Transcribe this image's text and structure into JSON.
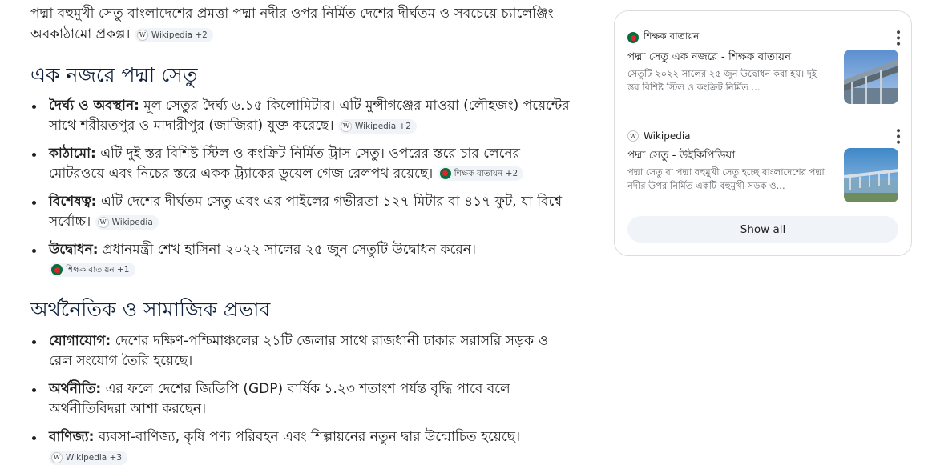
{
  "intro": {
    "text": "পদ্মা বহুমুখী সেতু বাংলাদেশের প্রমত্তা পদ্মা নদীর ওপর নির্মিত দেশের দীর্ঘতম ও সবচেয়ে চ্যালেঞ্জিং অবকাঠামো প্রকল্প।",
    "chip": "Wikipedia +2"
  },
  "section1": {
    "heading": "এক নজরে পদ্মা সেতু",
    "items": [
      {
        "label": "দৈর্ঘ্য ও অবস্থান:",
        "text": " মূল সেতুর দৈর্ঘ্য ৬.১৫ কিলোমিটার। এটি মুন্সীগঞ্জের মাওয়া (লৌহজং) পয়েন্টের সাথে শরীয়তপুর ও মাদারীপুর (জাজিরা) যুক্ত করেছে।",
        "chip": "Wikipedia +2"
      },
      {
        "label": "কাঠামো:",
        "text": " এটি দুই স্তর বিশিষ্ট স্টিল ও কংক্রিট নির্মিত ট্রাস সেতু। ওপরের স্তরে চার লেনের মোটরওয়ে এবং নিচের স্তরে একক ট্র্যাকের ডুয়েল গেজ রেলপথ রয়েছে।",
        "chip": "শিক্ষক বাতায়ন +2"
      },
      {
        "label": "বিশেষত্ব:",
        "text": " এটি দেশের দীর্ঘতম সেতু এবং এর পাইলের গভীরতা ১২৭ মিটার বা ৪১৭ ফুট, যা বিশ্বে সর্বোচ্চ।",
        "chip": "Wikipedia"
      },
      {
        "label": "উদ্বোধন:",
        "text": " প্রধানমন্ত্রী শেখ হাসিনা ২০২২ সালের ২৫ জুন সেতুটি উদ্বোধন করেন।",
        "chip": "শিক্ষক বাতায়ন +1"
      }
    ]
  },
  "section2": {
    "heading": "অর্থনৈতিক ও সামাজিক প্রভাব",
    "items": [
      {
        "label": "যোগাযোগ:",
        "text": " দেশের দক্ষিণ-পশ্চিমাঞ্চলের ২১টি জেলার সাথে রাজধানী ঢাকার সরাসরি সড়ক ও রেল সংযোগ তৈরি হয়েছে।"
      },
      {
        "label": "অর্থনীতি:",
        "text": " এর ফলে দেশের জিডিপি (GDP) বার্ষিক ১.২৩ শতাংশ পর্যন্ত বৃদ্ধি পাবে বলে অর্থনীতিবিদরা আশা করছেন।"
      },
      {
        "label": "বাণিজ্য:",
        "text": " ব্যবসা-বাণিজ্য, কৃষি পণ্য পরিবহন এবং শিল্পায়নের নতুন দ্বার উন্মোচিত হয়েছে।",
        "chip": "Wikipedia +3"
      }
    ]
  },
  "sources": {
    "cards": [
      {
        "site": "শিক্ষক বাতায়ন",
        "title": "পদ্মা সেতু এক নজরে - শিক্ষক বাতায়ন",
        "snippet": "সেতুটি ২০২২ সালের ২৫ জুন উদ্বোধন করা হয়। দুই স্তর বিশিষ্ট স্টিল ও কংক্রিট নির্মিত ..."
      },
      {
        "site": "Wikipedia",
        "title": "পদ্মা সেতু - উইকিপিডিয়া",
        "snippet": "পদ্মা সেতু বা পদ্মা বহুমুখী সেতু হচ্ছে বাংলাদেশের পদ্মা নদীর উপর নির্মিত একটি বহুমুখী সড়ক ও..."
      }
    ],
    "show_all": "Show all"
  }
}
